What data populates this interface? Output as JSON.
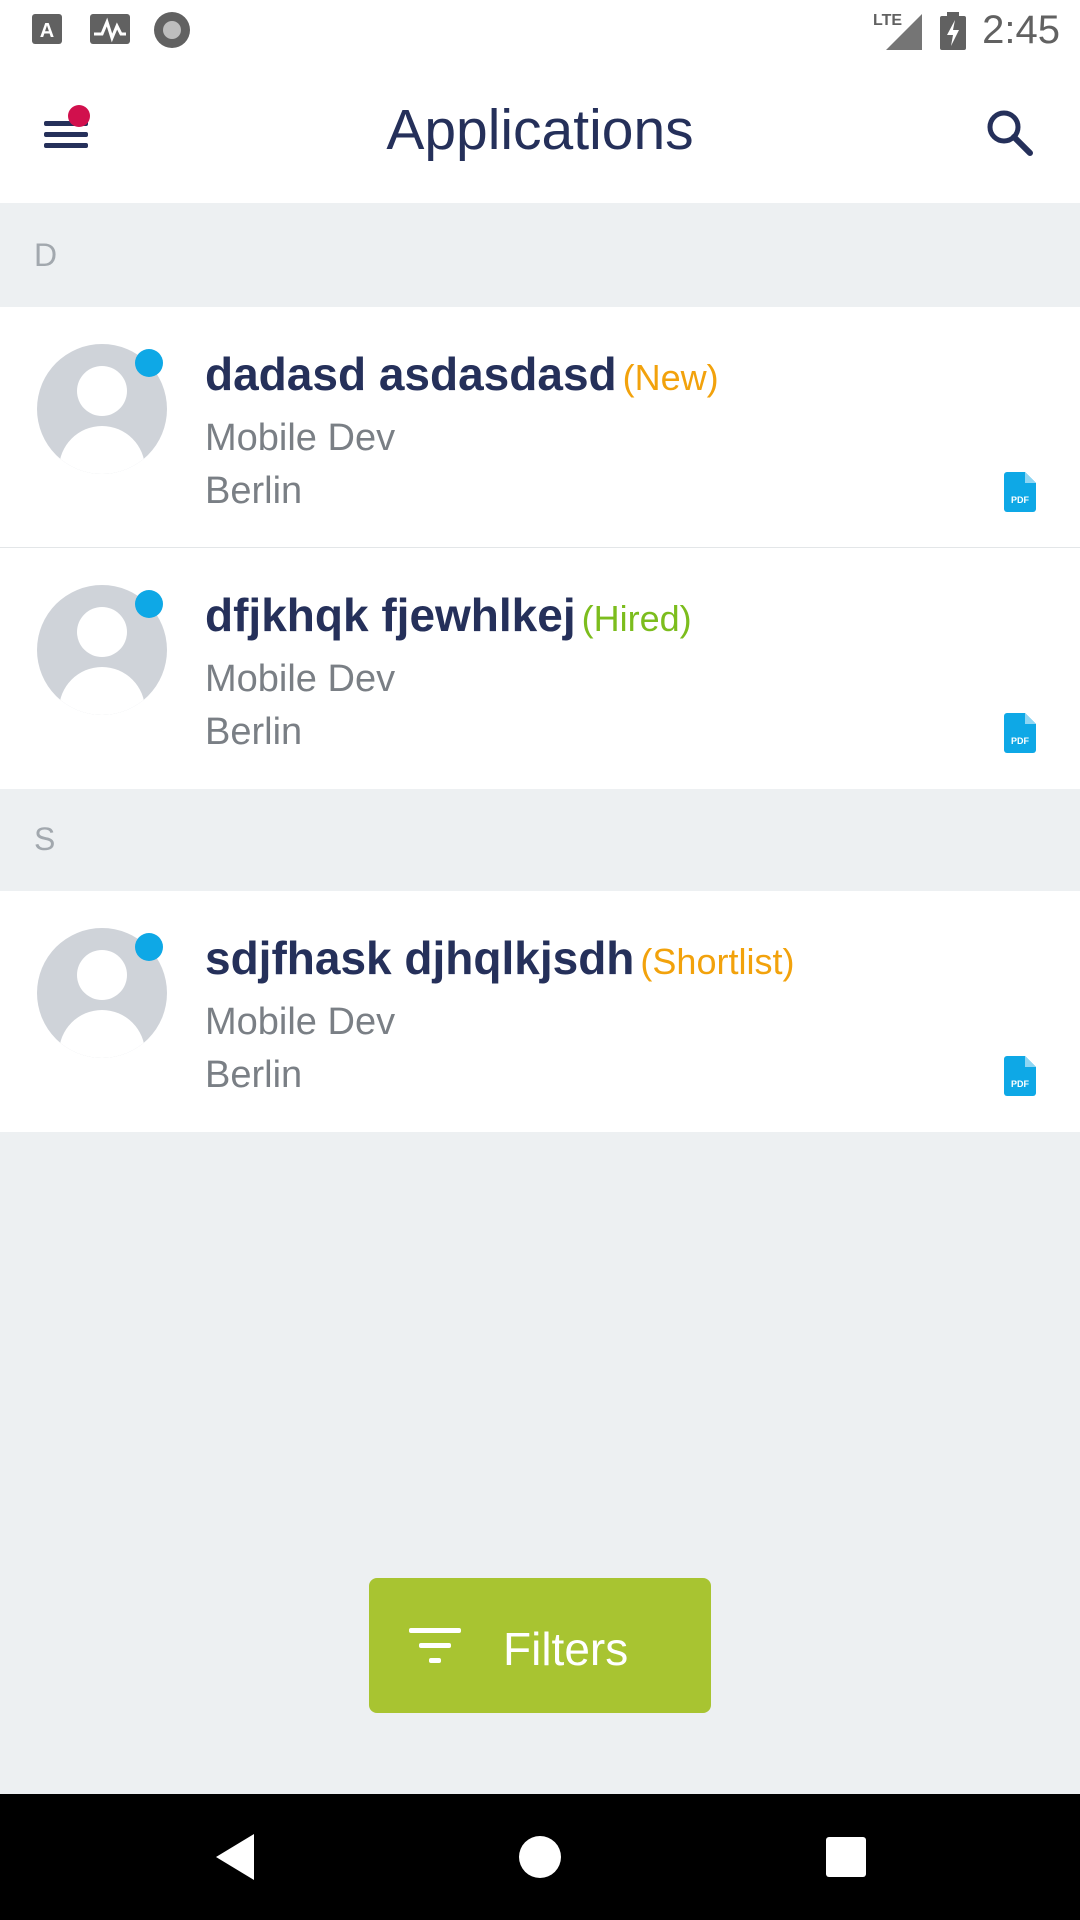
{
  "status_bar": {
    "time": "2:45",
    "network": "LTE",
    "icons": [
      "text-notification-icon",
      "activity-icon",
      "record-icon",
      "signal-icon",
      "battery-charging-icon"
    ]
  },
  "header": {
    "title": "Applications",
    "menu_icon": "hamburger-menu-icon",
    "search_icon": "search-icon"
  },
  "sections": [
    {
      "letter": "D",
      "items": [
        {
          "name": "dadasd asdasdasd",
          "status": "(New)",
          "status_color": "#f2a20c",
          "role": "Mobile Dev",
          "city": "Berlin"
        },
        {
          "name": "dfjkhqk fjewhlkej",
          "status": "(Hired)",
          "status_color": "#7cbd1d",
          "role": "Mobile Dev",
          "city": "Berlin"
        }
      ]
    },
    {
      "letter": "S",
      "items": [
        {
          "name": "sdjfhask djhqlkjsdh",
          "status": "(Shortlist)",
          "status_color": "#f2a20c",
          "role": "Mobile Dev",
          "city": "Berlin"
        }
      ]
    }
  ],
  "filters_button": {
    "label": "Filters",
    "color": "#a8c431"
  },
  "colors": {
    "primary_text": "#25305a",
    "accent_blue": "#0ea8e6",
    "notification": "#d1104d"
  }
}
